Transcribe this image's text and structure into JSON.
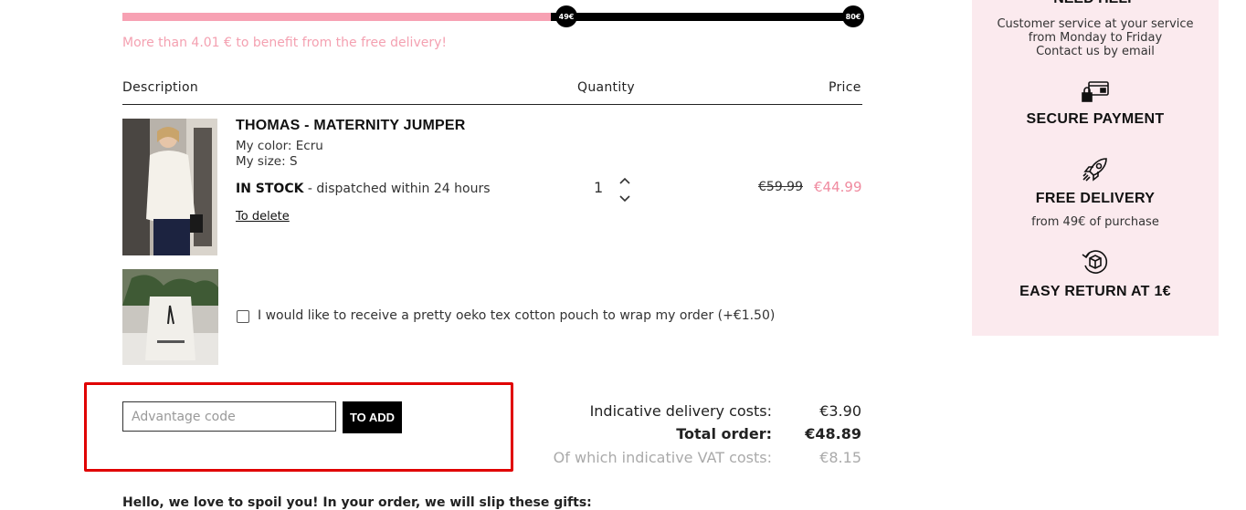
{
  "progress": {
    "fill_fraction": 0.58,
    "milestone_1": "49€",
    "milestone_2": "80€",
    "message": "More than 4.01 € to benefit from the free delivery!",
    "fill_color": "#f7a1b3"
  },
  "cart": {
    "headers": {
      "description": "Description",
      "quantity": "Quantity",
      "price": "Price"
    },
    "item": {
      "name": "THOMAS - MATERNITY JUMPER",
      "color": "My color: Ecru",
      "size": "My size: S",
      "stock_label": "IN STOCK",
      "stock_note": "- dispatched within 24 hours",
      "delete_label": "To delete",
      "quantity": "1",
      "price_old": "€59.99",
      "price_new": "€44.99"
    },
    "pouch": {
      "label": "I would like to receive a pretty oeko tex cotton pouch to wrap my order (+€1.50)",
      "checked": false
    }
  },
  "promo": {
    "placeholder": "Advantage code",
    "button": "TO ADD"
  },
  "totals": {
    "delivery_label": "Indicative delivery costs:",
    "delivery_value": "€3.90",
    "total_label": "Total order:",
    "total_value": "€48.89",
    "vat_label": "Of which indicative VAT costs:",
    "vat_value": "€8.15"
  },
  "gifts_line": "Hello, we love to spoil you! In your order, we will slip these gifts:",
  "panel": {
    "heading": "NEED HELP",
    "cs_lines": [
      "Customer service at your service",
      "from Monday to Friday",
      "Contact us by email"
    ],
    "secure": "SECURE PAYMENT",
    "free_delivery": "FREE DELIVERY",
    "free_delivery_sub": "from 49€ of purchase",
    "easy_return": "EASY RETURN AT 1€",
    "icons": [
      "card-lock-icon",
      "rocket-icon",
      "return-box-icon"
    ]
  }
}
